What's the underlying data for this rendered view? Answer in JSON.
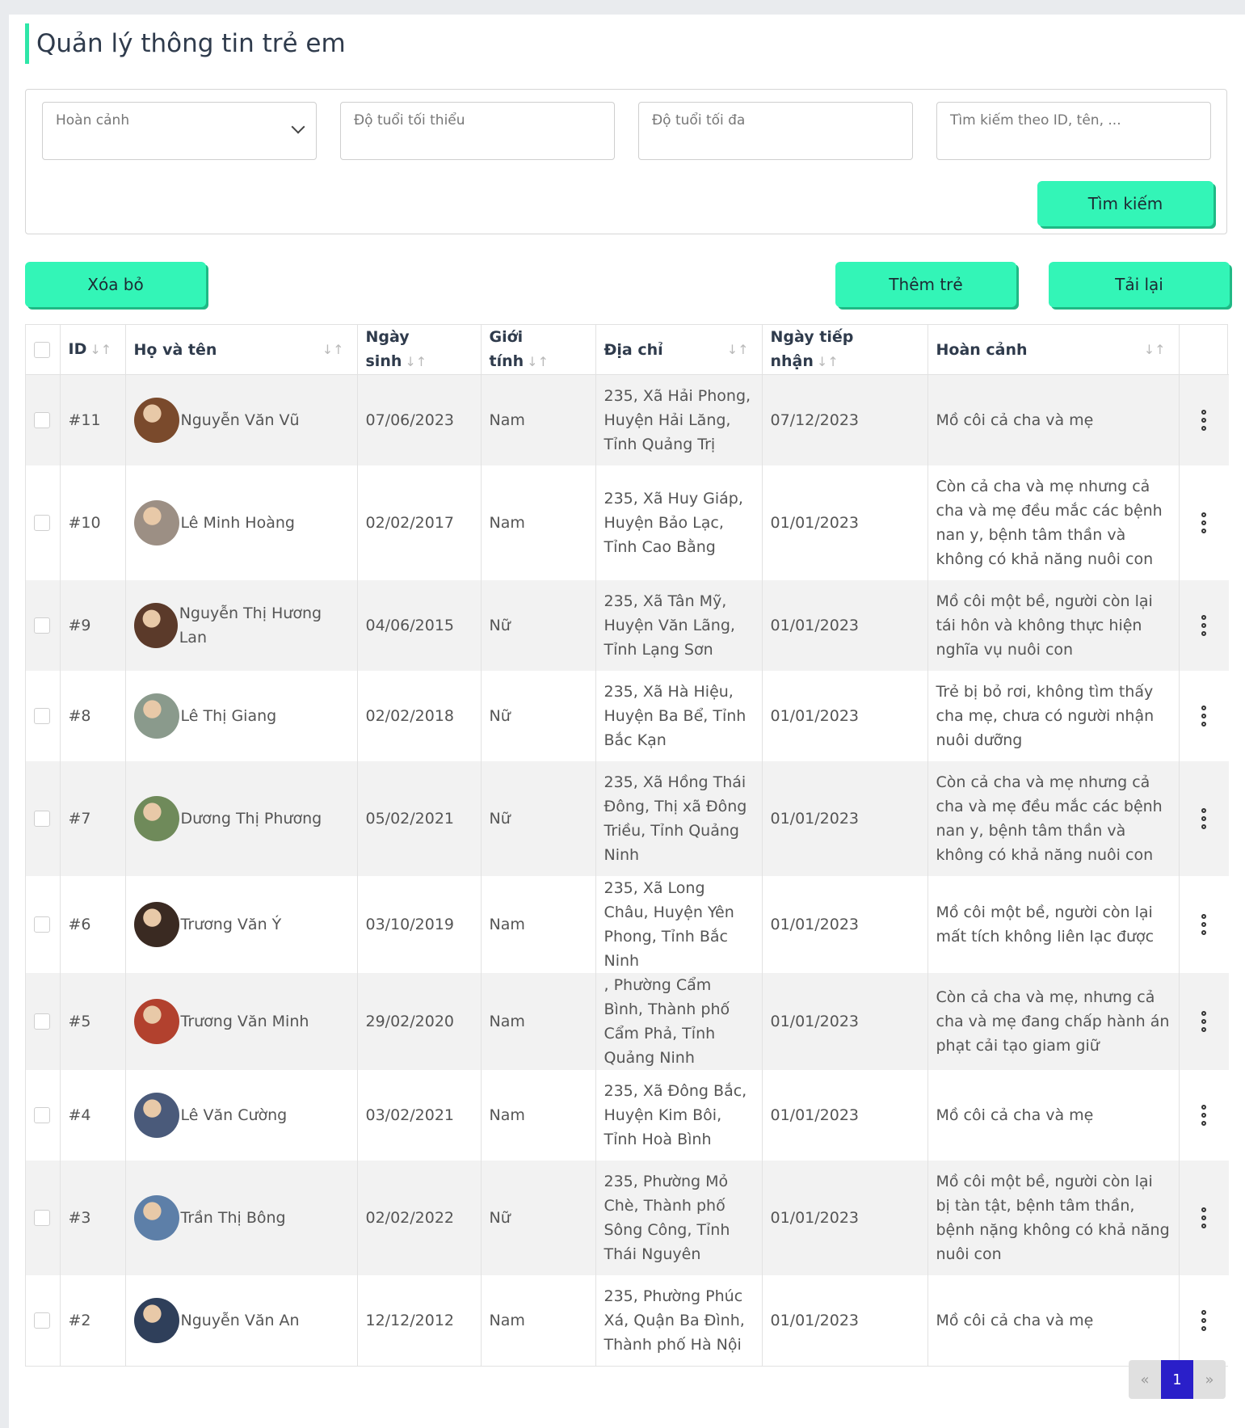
{
  "page": {
    "title": "Quản lý thông tin trẻ em"
  },
  "filters": {
    "circumstance_placeholder": "Hoàn cảnh",
    "min_age_placeholder": "Độ tuổi tối thiểu",
    "max_age_placeholder": "Độ tuổi tối đa",
    "search_placeholder": "Tìm kiếm theo ID, tên, ...",
    "search_button": "Tìm kiếm"
  },
  "actions": {
    "delete_button": "Xóa bỏ",
    "add_button": "Thêm trẻ",
    "reload_button": "Tải lại"
  },
  "table": {
    "columns": [
      "ID",
      "Họ và tên",
      "Ngày sinh",
      "Giới tính",
      "Địa chỉ",
      "Ngày tiếp nhận",
      "Hoàn cảnh"
    ],
    "sort_glyph": "↓↑",
    "rows": [
      {
        "id": "#11",
        "name": "Nguyễn Văn Vũ",
        "dob": "07/06/2023",
        "gender": "Nam",
        "address": "235, Xã Hải Phong, Huyện Hải Lăng, Tỉnh Quảng Trị",
        "received": "07/12/2023",
        "circumstance": "Mồ côi cả cha và mẹ",
        "avatar_color": "#7a4a2c"
      },
      {
        "id": "#10",
        "name": "Lê Minh Hoàng",
        "dob": "02/02/2017",
        "gender": "Nam",
        "address": "235, Xã Huy Giáp, Huyện Bảo Lạc, Tỉnh Cao Bằng",
        "received": "01/01/2023",
        "circumstance": "Còn cả cha và mẹ nhưng cả cha và mẹ đều mắc các bệnh nan y, bệnh tâm thần và không có khả năng nuôi con",
        "avatar_color": "#9c8f84"
      },
      {
        "id": "#9",
        "name": "Nguyễn Thị Hương Lan",
        "dob": "04/06/2015",
        "gender": "Nữ",
        "address": "235, Xã Tân Mỹ, Huyện Văn Lãng, Tỉnh Lạng Sơn",
        "received": "01/01/2023",
        "circumstance": "Mồ côi một bề, người còn lại tái hôn và không thực hiện nghĩa vụ nuôi con",
        "avatar_color": "#5b3a2a"
      },
      {
        "id": "#8",
        "name": "Lê Thị Giang",
        "dob": "02/02/2018",
        "gender": "Nữ",
        "address": "235, Xã Hà Hiệu, Huyện Ba Bể, Tỉnh Bắc Kạn",
        "received": "01/01/2023",
        "circumstance": "Trẻ bị bỏ rơi, không tìm thấy cha mẹ, chưa có người nhận nuôi dưỡng",
        "avatar_color": "#8a9a8c"
      },
      {
        "id": "#7",
        "name": "Dương Thị Phương",
        "dob": "05/02/2021",
        "gender": "Nữ",
        "address": "235, Xã Hồng Thái Đông, Thị xã Đông Triều, Tỉnh Quảng Ninh",
        "received": "01/01/2023",
        "circumstance": "Còn cả cha và mẹ nhưng cả cha và mẹ đều mắc các bệnh nan y, bệnh tâm thần và không có khả năng nuôi con",
        "avatar_color": "#6f8a5a"
      },
      {
        "id": "#6",
        "name": "Trương Văn Ý",
        "dob": "03/10/2019",
        "gender": "Nam",
        "address": "235, Xã Long Châu, Huyện Yên Phong, Tỉnh Bắc Ninh",
        "received": "01/01/2023",
        "circumstance": "Mồ côi một bề, người còn lại mất tích không liên lạc được",
        "avatar_color": "#3a2a22"
      },
      {
        "id": "#5",
        "name": "Trương Văn Minh",
        "dob": "29/02/2020",
        "gender": "Nam",
        "address": ", Phường Cẩm Bình, Thành phố Cẩm Phả, Tỉnh Quảng Ninh",
        "received": "01/01/2023",
        "circumstance": "Còn cả cha và mẹ, nhưng cả cha và mẹ đang chấp hành án phạt cải tạo giam giữ",
        "avatar_color": "#b2412e"
      },
      {
        "id": "#4",
        "name": "Lê Văn Cường",
        "dob": "03/02/2021",
        "gender": "Nam",
        "address": "235, Xã Đông Bắc, Huyện Kim Bôi, Tỉnh Hoà Bình",
        "received": "01/01/2023",
        "circumstance": "Mồ côi cả cha và mẹ",
        "avatar_color": "#4a5a7a"
      },
      {
        "id": "#3",
        "name": "Trần Thị Bông",
        "dob": "02/02/2022",
        "gender": "Nữ",
        "address": "235, Phường Mỏ Chè, Thành phố Sông Công, Tỉnh Thái Nguyên",
        "received": "01/01/2023",
        "circumstance": "Mồ côi một bề, người còn lại bị tàn tật, bệnh tâm thần, bệnh nặng không có khả năng nuôi con",
        "avatar_color": "#5d7fa8"
      },
      {
        "id": "#2",
        "name": "Nguyễn Văn An",
        "dob": "12/12/2012",
        "gender": "Nam",
        "address": "235, Phường Phúc Xá, Quận Ba Đình, Thành phố Hà Nội",
        "received": "01/01/2023",
        "circumstance": "Mồ côi cả cha và mẹ",
        "avatar_color": "#2f3f5a"
      }
    ]
  },
  "pagination": {
    "prev": "«",
    "current": "1",
    "next": "»"
  },
  "colors": {
    "accent": "#33f5b7",
    "title_bar": "#2ee6a8",
    "active_page": "#2a1fc9"
  }
}
